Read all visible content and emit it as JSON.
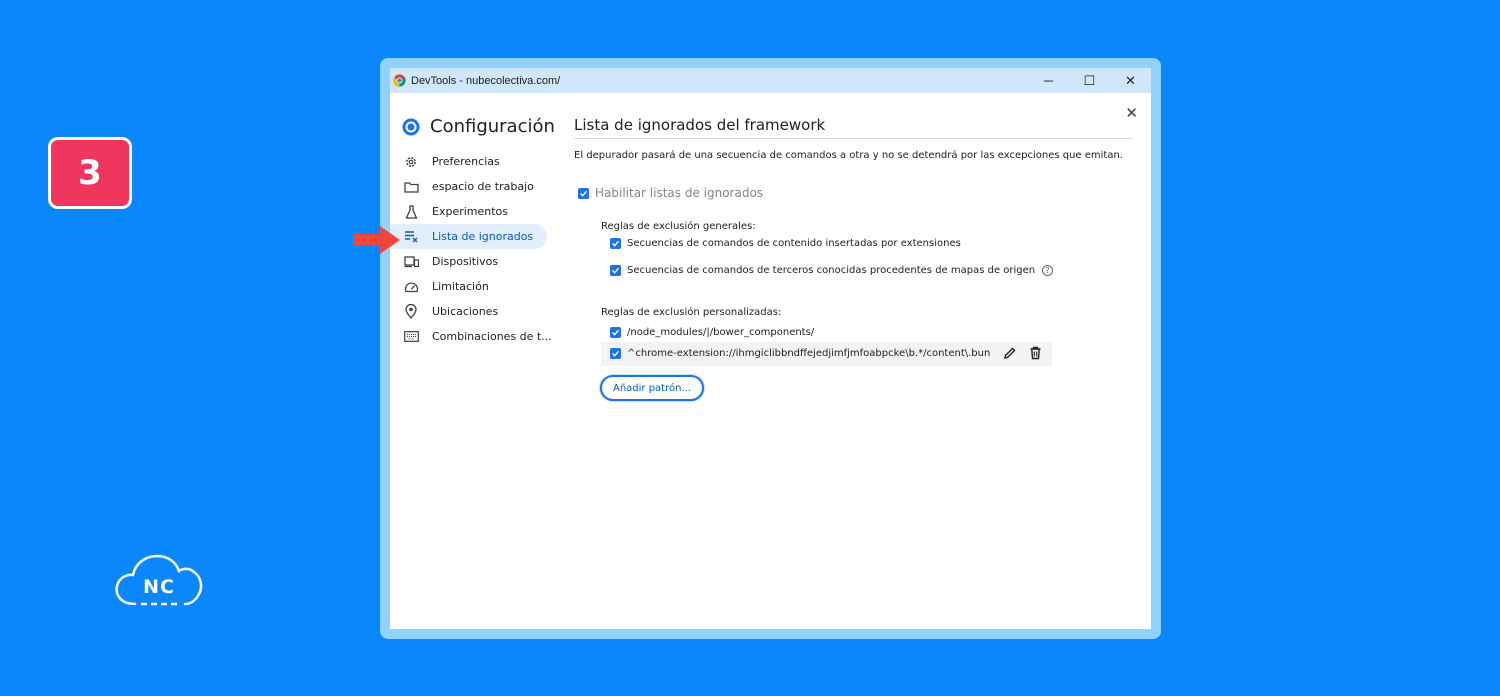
{
  "badge": {
    "step": "3"
  },
  "logo": {
    "text": "NC"
  },
  "window": {
    "title": "DevTools - nubecolectiva.com/",
    "controls": {
      "minimize": "─",
      "maximize": "☐",
      "close": "✕"
    },
    "panel_close": "✕"
  },
  "sidebar": {
    "title": "Configuración",
    "items": [
      {
        "label": "Preferencias",
        "icon": "gear-icon"
      },
      {
        "label": "espacio de trabajo",
        "icon": "folder-icon"
      },
      {
        "label": "Experimentos",
        "icon": "flask-icon"
      },
      {
        "label": "Lista de ignorados",
        "icon": "ignore-list-icon",
        "active": true
      },
      {
        "label": "Dispositivos",
        "icon": "devices-icon"
      },
      {
        "label": "Limitación",
        "icon": "speedometer-icon"
      },
      {
        "label": "Ubicaciones",
        "icon": "location-pin-icon"
      },
      {
        "label": "Combinaciones de t...",
        "icon": "keyboard-icon"
      }
    ]
  },
  "main": {
    "title": "Lista de ignorados del framework",
    "description": "El depurador pasará de una secuencia de comandos a otra y no se detendrá por las excepciones que emitan.",
    "enable_label": "Habilitar listas de ignorados",
    "general": {
      "label": "Reglas de exclusión generales:",
      "rules": [
        "Secuencias de comandos de contenido insertadas por extensiones",
        "Secuencias de comandos de terceros conocidas procedentes de mapas de origen"
      ]
    },
    "custom": {
      "label": "Reglas de exclusión personalizadas:",
      "patterns": [
        "/node_modules/|/bower_components/",
        "^chrome-extension://ihmgiclibbndffejedjimfjmfoabpcke\\b.*/content\\.bundle\\.js$"
      ]
    },
    "add_button": "Añadir patrón..."
  },
  "colors": {
    "background": "#0a88fb",
    "accent": "#1a73e8",
    "badge": "#f0365f"
  }
}
